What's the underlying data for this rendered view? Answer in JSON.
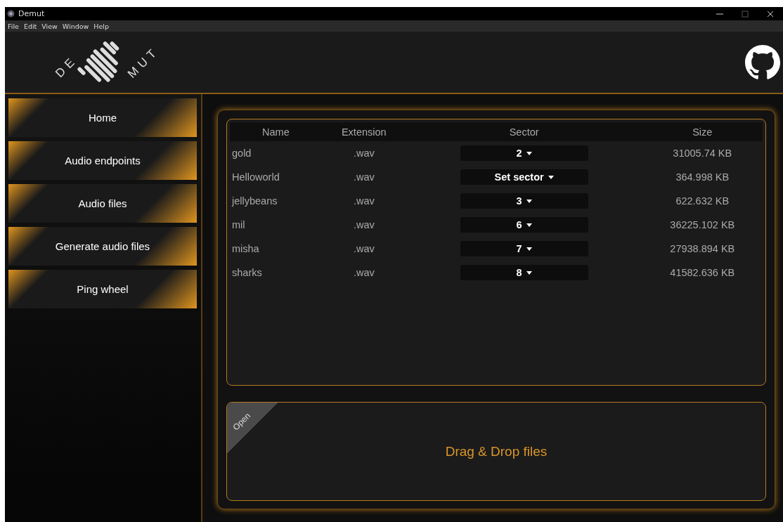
{
  "window": {
    "title": "Demut"
  },
  "menu": [
    "File",
    "Edit",
    "View",
    "Window",
    "Help"
  ],
  "logo": {
    "left": "DE",
    "right": "MUT"
  },
  "sidebar": {
    "items": [
      {
        "label": "Home"
      },
      {
        "label": "Audio endpoints"
      },
      {
        "label": "Audio files"
      },
      {
        "label": "Generate audio files"
      },
      {
        "label": "Ping wheel"
      }
    ]
  },
  "table": {
    "columns": [
      "Name",
      "Extension",
      "Sector",
      "Size"
    ],
    "rows": [
      {
        "name": "gold",
        "extension": ".wav",
        "sector": "2",
        "size": "31005.74 KB"
      },
      {
        "name": "Helloworld",
        "extension": ".wav",
        "sector": "Set sector",
        "size": "364.998 KB"
      },
      {
        "name": "jellybeans",
        "extension": ".wav",
        "sector": "3",
        "size": "622.632 KB"
      },
      {
        "name": "mil",
        "extension": ".wav",
        "sector": "6",
        "size": "36225.102 KB"
      },
      {
        "name": "misha",
        "extension": ".wav",
        "sector": "7",
        "size": "27938.894 KB"
      },
      {
        "name": "sharks",
        "extension": ".wav",
        "sector": "8",
        "size": "41582.636 KB"
      }
    ]
  },
  "dropzone": {
    "corner_label": "Open",
    "text": "Drag & Drop files"
  }
}
